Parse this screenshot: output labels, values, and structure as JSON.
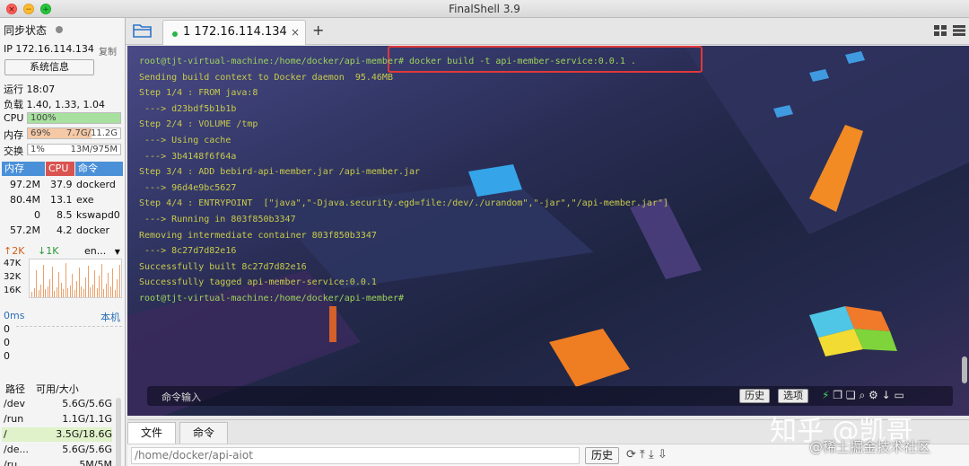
{
  "window": {
    "title": "FinalShell 3.9",
    "traffic_lights": [
      "close",
      "minimize",
      "zoom"
    ]
  },
  "sidebar": {
    "sync_label": "同步状态",
    "ip_label": "IP 172.16.114.134",
    "copy_label": "复制",
    "sysinfo_button": "系统信息",
    "uptime": "运行 18:07",
    "load": "负载 1.40, 1.33, 1.04",
    "cpu": {
      "label": "CPU",
      "value": "100%",
      "percent": 100,
      "color": "#a8e0a0"
    },
    "mem": {
      "label": "内存",
      "percent_text": "69%",
      "usage": "7.7G/11.2G",
      "percent": 69,
      "color": "#f6c9a6"
    },
    "swap": {
      "label": "交换",
      "percent_text": "1%",
      "usage": "13M/975M",
      "percent": 1,
      "color": "#e8e8e8"
    },
    "process_headers": [
      "内存",
      "CPU",
      "命令"
    ],
    "processes": [
      {
        "mem": "97.2M",
        "cpu": "37.9",
        "cmd": "dockerd"
      },
      {
        "mem": "80.4M",
        "cpu": "13.1",
        "cmd": "exe"
      },
      {
        "mem": "0",
        "cpu": "8.5",
        "cmd": "kswapd0"
      },
      {
        "mem": "57.2M",
        "cpu": "4.2",
        "cmd": "docker"
      }
    ],
    "net": {
      "up": "2K",
      "down": "1K",
      "iface": "en...",
      "scale": [
        "47K",
        "32K",
        "16K"
      ]
    },
    "ping": {
      "label": "0ms",
      "host": "本机",
      "values": [
        "0",
        "0",
        "0"
      ]
    },
    "disk_headers": [
      "路径",
      "可用/大小"
    ],
    "disks": [
      {
        "path": "/dev",
        "size": "5.6G/5.6G"
      },
      {
        "path": "/run",
        "size": "1.1G/1.1G"
      },
      {
        "path": "/",
        "size": "3.5G/18.6G"
      },
      {
        "path": "/de...",
        "size": "5.6G/5.6G"
      },
      {
        "path": "/ru...",
        "size": "5M/5M"
      }
    ]
  },
  "tabs": {
    "active": {
      "label": "1 172.16.114.134"
    },
    "add_label": "+"
  },
  "terminal": {
    "lines": [
      {
        "text": "root@tjt-virtual-machine:/home/docker/api-member# docker build -t api-member-service:0.0.1 .",
        "color": "green"
      },
      {
        "text": "Sending build context to Docker daemon  95.46MB",
        "color": "yellow"
      },
      {
        "text": "Step 1/4 : FROM java:8",
        "color": "yellow"
      },
      {
        "text": " ---> d23bdf5b1b1b",
        "color": "yellow"
      },
      {
        "text": "Step 2/4 : VOLUME /tmp",
        "color": "yellow"
      },
      {
        "text": " ---> Using cache",
        "color": "yellow"
      },
      {
        "text": " ---> 3b4148f6f64a",
        "color": "yellow"
      },
      {
        "text": "Step 3/4 : ADD bebird-api-member.jar /api-member.jar",
        "color": "yellow"
      },
      {
        "text": " ---> 96d4e9bc5627",
        "color": "yellow"
      },
      {
        "text": "Step 4/4 : ENTRYPOINT  [\"java\",\"-Djava.security.egd=file:/dev/./urandom\",\"-jar\",\"/api-member.jar\"]",
        "color": "yellow"
      },
      {
        "text": " ---> Running in 803f850b3347",
        "color": "yellow"
      },
      {
        "text": "Removing intermediate container 803f850b3347",
        "color": "yellow"
      },
      {
        "text": " ---> 8c27d7d82e16",
        "color": "yellow"
      },
      {
        "text": "Successfully built 8c27d7d82e16",
        "color": "yellow"
      },
      {
        "text": "Successfully tagged api-member-service:0.0.1",
        "color": "yellow"
      },
      {
        "text": "root@tjt-virtual-machine:/home/docker/api-member#",
        "color": "green"
      }
    ],
    "command_placeholder": "命令输入",
    "history_button": "历史",
    "options_button": "选项"
  },
  "bottom": {
    "tabs": [
      "文件",
      "命令"
    ],
    "path_value": "/home/docker/api-aiot",
    "history_button": "历史"
  },
  "watermark": {
    "line1": "知乎 @凯哥",
    "line2": "@稀土掘金技术社区"
  },
  "colors": {
    "cpu_header": "#d9534f",
    "mem_header": "#4a90d9",
    "cmd_header": "#4a90d9",
    "highlight": "#e0383a"
  }
}
